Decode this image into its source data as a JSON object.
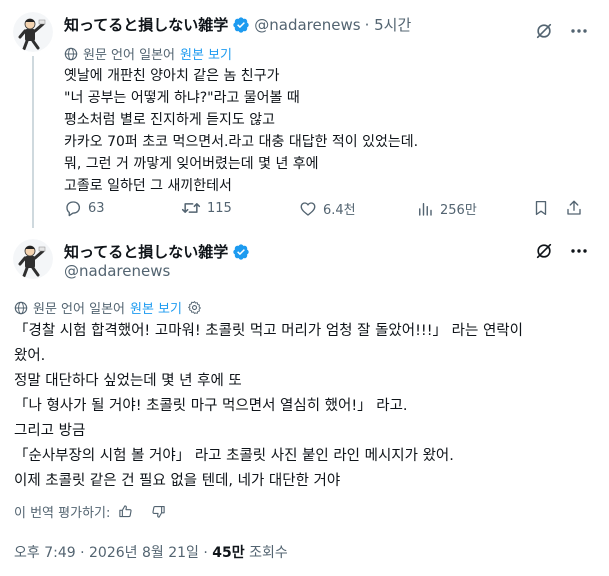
{
  "tweet1": {
    "display_name": "知ってると損しない雑学",
    "handle": "@nadarenews",
    "time": "· 5시간",
    "translate_note": "원문 언어 일본어",
    "show_original": "원본 보기",
    "lines": [
      "옛날에 개판친 양아치 같은 놈 친구가",
      "\"너 공부는 어떻게 하냐?\"라고 물어볼 때",
      "평소처럼 별로 진지하게 듣지도 않고",
      "카카오 70퍼 초코 먹으면서.라고 대충 대답한 적이 있었는데.",
      "뭐, 그런 거 까맣게 잊어버렸는데 몇 년 후에",
      "고졸로 일하던 그 새끼한테서"
    ],
    "actions": {
      "replies": "63",
      "retweets": "115",
      "likes": "6.4천",
      "views": "256만"
    }
  },
  "tweet2": {
    "display_name": "知ってると損しない雑学",
    "handle": "@nadarenews",
    "translate_note": "원문 언어 일본어",
    "show_original": "원본 보기",
    "lines": [
      "「경찰 시험 합격했어! 고마워! 초콜릿 먹고 머리가 엄청 잘 돌았어!!!」 라는 연락이",
      "왔어.",
      "정말 대단하다 싶었는데 몇 년 후에 또",
      "「나 형사가 될 거야! 초콜릿 마구 먹으면서 열심히 했어!」 라고.",
      "그리고 방금",
      "「순사부장의 시험 볼 거야」 라고 초콜릿 사진 붙인 라인 메시지가 왔어.",
      "이제 초콜릿 같은 건 필요 없을 텐데, 네가 대단한 거야"
    ],
    "rate_translation": "이 번역 평가하기:",
    "timestamp": "오후 7:49 · 2026년 8월 21일 · ",
    "view_count": "45만",
    "view_label": " 조회수"
  },
  "colors": {
    "accent": "#1d9bf0",
    "muted": "#536471",
    "text": "#0f1419",
    "thread_line": "#cfd9de"
  },
  "icons": [
    "avatar-illustration",
    "verified-badge-icon",
    "grok-icon",
    "more-icon",
    "globe-icon",
    "gear-icon",
    "reply-icon",
    "retweet-icon",
    "like-icon",
    "views-icon",
    "bookmark-icon",
    "share-icon",
    "thumbs-up-icon",
    "thumbs-down-icon"
  ]
}
